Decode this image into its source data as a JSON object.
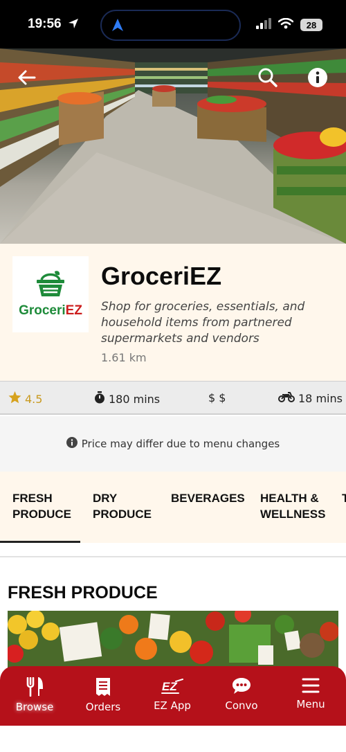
{
  "status_bar": {
    "time": "19:56",
    "battery": "28"
  },
  "store": {
    "logo_text_green": "Groceri",
    "logo_text_red": "EZ",
    "name": "GroceriEZ",
    "description": "Shop for groceries, essentials, and household items from partnered supermarkets and vendors",
    "distance": "1.61 km"
  },
  "info": {
    "rating": "4.5",
    "prep_time": "180 mins",
    "price_level": "$ $",
    "delivery_time": "18 mins"
  },
  "notice": "Price may differ due to menu changes",
  "tabs": [
    {
      "label": "FRESH PRODUCE"
    },
    {
      "label": "DRY PRODUCE"
    },
    {
      "label": "BEVERAGES"
    },
    {
      "label": "HEALTH & WELLNESS"
    },
    {
      "label": "T"
    }
  ],
  "section": {
    "title": "FRESH PRODUCE"
  },
  "bottom_nav": [
    {
      "label": "Browse",
      "icon": "fork-knife-icon"
    },
    {
      "label": "Orders",
      "icon": "receipt-icon"
    },
    {
      "label": "EZ App",
      "icon": "ez-logo-icon"
    },
    {
      "label": "Convo",
      "icon": "chat-bubble-icon"
    },
    {
      "label": "Menu",
      "icon": "hamburger-icon"
    }
  ],
  "colors": {
    "brand_red": "#b5111a",
    "logo_green": "#1e8b3a",
    "star": "#d6a21e",
    "header_bg": "#fff7ec"
  }
}
